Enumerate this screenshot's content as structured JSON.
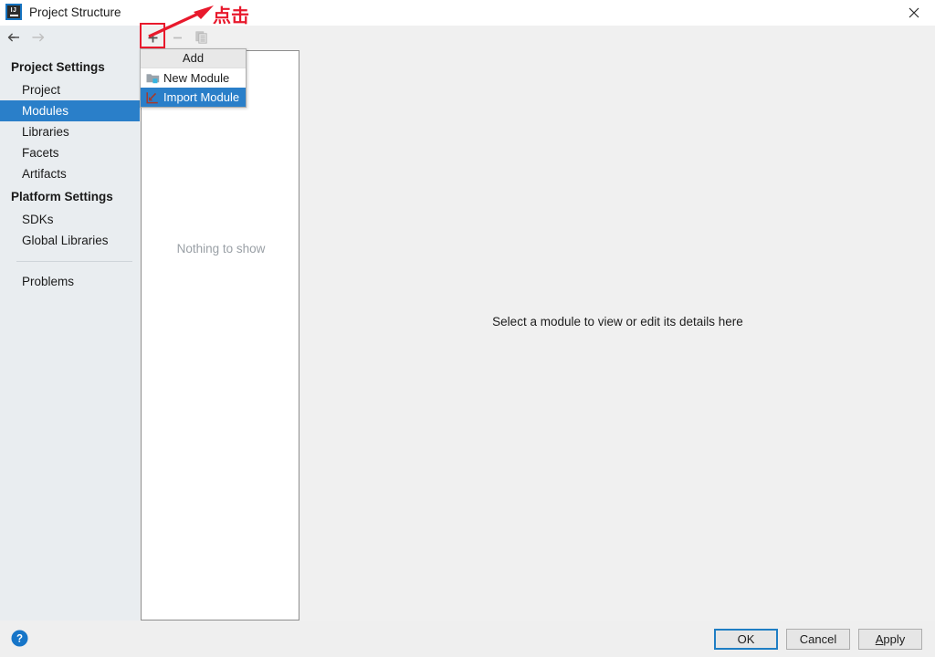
{
  "window": {
    "title": "Project Structure",
    "logo_icon": "intellij-idea-logo",
    "close_icon": "close-icon"
  },
  "navigation": {
    "back_icon": "arrow-left-icon",
    "forward_icon": "arrow-right-icon",
    "back_enabled": "true",
    "forward_enabled": "false"
  },
  "sidebar": {
    "groups": [
      {
        "label": "Project Settings",
        "items": [
          {
            "label": "Project",
            "selected": false
          },
          {
            "label": "Modules",
            "selected": true
          },
          {
            "label": "Libraries",
            "selected": false
          },
          {
            "label": "Facets",
            "selected": false
          },
          {
            "label": "Artifacts",
            "selected": false
          }
        ]
      },
      {
        "label": "Platform Settings",
        "items": [
          {
            "label": "SDKs",
            "selected": false
          },
          {
            "label": "Global Libraries",
            "selected": false
          }
        ]
      }
    ],
    "footer_item": "Problems"
  },
  "list_panel": {
    "toolbar": {
      "add_icon": "plus-icon",
      "add_label": "Add",
      "remove_icon": "minus-icon",
      "remove_enabled": "false",
      "copy_icon": "copy-icon",
      "copy_enabled": "false"
    },
    "empty_text": "Nothing to show"
  },
  "menu": {
    "header": "Add",
    "items": [
      {
        "label": "New Module",
        "icon": "new-module-folder-icon",
        "highlighted": false
      },
      {
        "label": "Import Module",
        "icon": "import-module-arrow-icon",
        "highlighted": true
      }
    ]
  },
  "detail_panel": {
    "message": "Select a module to view or edit its details here"
  },
  "annotation": {
    "text": "点击",
    "color": "#e8192c",
    "arrow_icon": "red-arrow-icon",
    "highlight_target": "add-button"
  },
  "bottom_bar": {
    "help_icon": "help-question-icon",
    "buttons": [
      {
        "label": "OK",
        "primary": true
      },
      {
        "label": "Cancel",
        "primary": false
      },
      {
        "label": "Apply",
        "primary": false,
        "mnemonic": "A"
      }
    ]
  },
  "colors": {
    "selection_blue": "#2a7fc9",
    "sidebar_bg": "#e9edf0",
    "panel_bg": "#f0f0f0",
    "annotation_red": "#e8192c",
    "focus_blue": "#1f7ec4"
  }
}
